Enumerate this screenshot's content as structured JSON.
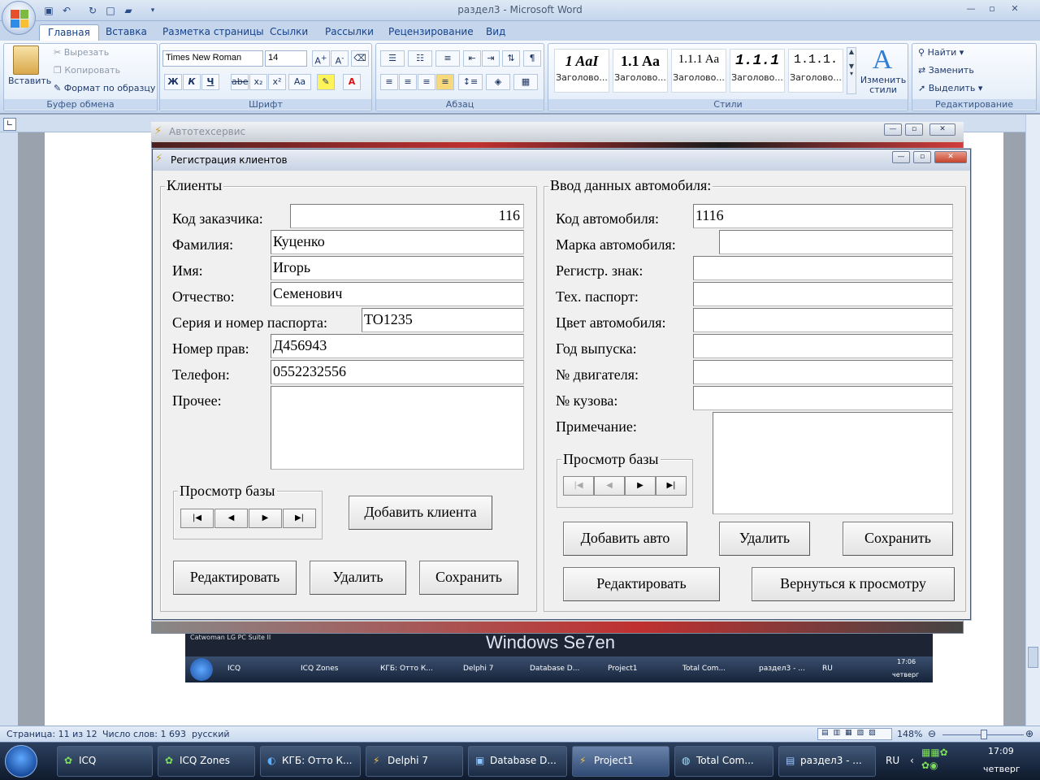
{
  "word": {
    "title": "раздел3 - Microsoft Word",
    "tabs": [
      "Главная",
      "Вставка",
      "Разметка страницы",
      "Ссылки",
      "Рассылки",
      "Рецензирование",
      "Вид"
    ],
    "clipboard": {
      "paste": "Вставить",
      "cut": "Вырезать",
      "copy": "Копировать",
      "format_painter": "Формат по образцу",
      "label": "Буфер обмена"
    },
    "font": {
      "name": "Times New Roman",
      "size": "14",
      "label": "Шрифт",
      "bold": "Ж",
      "italic": "К",
      "underline": "Ч",
      "strike": "abe",
      "sub": "x₂",
      "sup": "x²",
      "case": "Aa"
    },
    "paragraph": {
      "label": "Абзац"
    },
    "styles": {
      "label": "Стили",
      "items": [
        {
          "sample": "1 AaI",
          "name": "Заголово..."
        },
        {
          "sample": "1.1 Aa",
          "name": "Заголово..."
        },
        {
          "sample": "1.1.1 Aa",
          "name": "Заголово..."
        },
        {
          "sample": "1.1.1",
          "name": "Заголово..."
        },
        {
          "sample": "1.1.1.",
          "name": "Заголово..."
        }
      ],
      "change": "Изменить стили"
    },
    "editing": {
      "label": "Редактирование",
      "find": "Найти",
      "replace": "Заменить",
      "select": "Выделить"
    },
    "status": {
      "page": "Страница: 11 из 12",
      "words": "Число слов: 1 693",
      "lang": "русский",
      "zoom": "148%"
    }
  },
  "auto_window": {
    "title": "Автотехсервис"
  },
  "dialog": {
    "title": "Регистрация клиентов",
    "clients": {
      "caption": "Клиенты",
      "fields": [
        {
          "label": "Код заказчика:",
          "value": "116"
        },
        {
          "label": "Фамилия:",
          "value": "Куценко"
        },
        {
          "label": "Имя:",
          "value": "Игорь"
        },
        {
          "label": "Отчество:",
          "value": "Семенович"
        },
        {
          "label": "Серия и номер паспорта:",
          "value": "ТО1235"
        },
        {
          "label": "Номер прав:",
          "value": "Д456943"
        },
        {
          "label": "Телефон:",
          "value": "0552232556"
        }
      ],
      "other_label": "Прочее:",
      "browse_caption": "Просмотр базы",
      "add_button": "Добавить клиента",
      "edit_button": "Редактировать",
      "delete_button": "Удалить",
      "save_button": "Сохранить"
    },
    "car": {
      "caption": "Ввод данных автомобиля:",
      "fields": [
        {
          "label": "Код автомобиля:",
          "value": "1116"
        },
        {
          "label": "Марка автомобиля:",
          "value": ""
        },
        {
          "label": "Регистр. знак:",
          "value": ""
        },
        {
          "label": "Тех. паспорт:",
          "value": ""
        },
        {
          "label": "Цвет автомобиля:",
          "value": ""
        },
        {
          "label": "Год выпуска:",
          "value": ""
        },
        {
          "label": "№ двигателя:",
          "value": ""
        },
        {
          "label": "№ кузова:",
          "value": ""
        }
      ],
      "note_label": "Примечание:",
      "browse_caption": "Просмотр базы",
      "add_button": "Добавить авто",
      "delete_button": "Удалить",
      "save_button": "Сохранить",
      "edit_button": "Редактировать",
      "back_button": "Вернуться к просмотру"
    },
    "nav": {
      "first": "|◀",
      "prior": "◀",
      "next": "▶",
      "last": "▶|"
    }
  },
  "inner_screenshot": {
    "text": "Windows Se7en",
    "label": "Catwoman   LG PC Suite II",
    "clock": "17:06",
    "day": "четверг"
  },
  "taskbar": {
    "items": [
      "ICQ",
      "ICQ Zones",
      "КГБ: Отто К...",
      "Delphi 7",
      "Database D...",
      "Project1",
      "Total Com...",
      "раздел3 - ..."
    ],
    "lang": "RU",
    "clock": "17:09",
    "day": "четверг"
  },
  "colors": {
    "ribbon": "#d9e5f4",
    "taskbar": "#1c2c45",
    "dialog": "#f0f0f0"
  }
}
